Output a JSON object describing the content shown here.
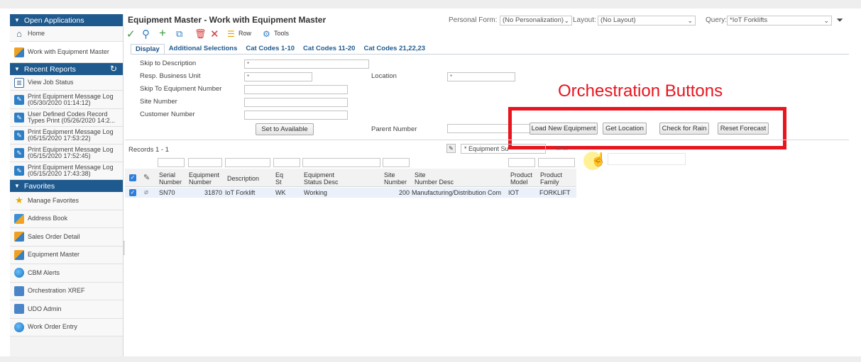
{
  "sidebar": {
    "open_apps_header": "Open Applications",
    "home": "Home",
    "open_item": "Work with Equipment Master",
    "recent_reports_header": "Recent Reports",
    "recent_reports": [
      {
        "line1": "View Job Status",
        "line2": ""
      },
      {
        "line1": "Print Equipment Message Log",
        "line2": "(05/30/2020 01:14:12)"
      },
      {
        "line1": "User Defined Codes Record",
        "line2": "Types Print (05/26/2020 14:2..."
      },
      {
        "line1": "Print Equipment Message Log",
        "line2": "(05/15/2020 17:53:22)"
      },
      {
        "line1": "Print Equipment Message Log",
        "line2": "(05/15/2020 17:52:45)"
      },
      {
        "line1": "Print Equipment Message Log",
        "line2": "(05/15/2020 17:43:38)"
      }
    ],
    "favorites_header": "Favorites",
    "favorites": [
      {
        "label": "Manage Favorites",
        "icon": "star-icon"
      },
      {
        "label": "Address Book",
        "icon": "people-icon"
      },
      {
        "label": "Sales Order Detail",
        "icon": "people-icon"
      },
      {
        "label": "Equipment Master",
        "icon": "people-icon"
      },
      {
        "label": "CBM Alerts",
        "icon": "globe-icon"
      },
      {
        "label": "Orchestration XREF",
        "icon": "monitor-icon"
      },
      {
        "label": "UDO Admin",
        "icon": "monitor-icon"
      },
      {
        "label": "Work Order Entry",
        "icon": "globe-icon"
      }
    ]
  },
  "header": {
    "title": "Equipment Master - Work with Equipment Master",
    "personal_form_label": "Personal Form:",
    "personal_form_value": "(No Personalization)",
    "layout_label": "Layout:",
    "layout_value": "(No Layout)",
    "query_label": "Query:",
    "query_value": "*IoT Forklifts"
  },
  "toolbar": {
    "row_label": "Row",
    "tools_label": "Tools"
  },
  "tabs": [
    "Display",
    "Additional Selections",
    "Cat Codes 1-10",
    "Cat Codes 11-20",
    "Cat Codes 21,22,23"
  ],
  "form": {
    "skip_desc_label": "Skip to Description",
    "skip_desc_value": "*",
    "bu_label": "Resp. Business Unit",
    "bu_value": "*",
    "location_label": "Location",
    "location_value": "*",
    "skip_equip_label": "Skip To Equipment Number",
    "site_label": "Site Number",
    "customer_label": "Customer Number",
    "parent_label": "Parent Number",
    "set_available_button": "Set to Available"
  },
  "orchestration": {
    "annotation": "Orchestration Buttons",
    "buttons": [
      "Load New Equipment",
      "Get Location",
      "Check for Rain",
      "Reset Forecast"
    ]
  },
  "grid": {
    "records": "Records 1 - 1",
    "format_value": "* Equipment Su",
    "columns": [
      {
        "l1": "Serial",
        "l2": "Number"
      },
      {
        "l1": "Equipment",
        "l2": "Number"
      },
      {
        "l1": "Description",
        "l2": ""
      },
      {
        "l1": "Eq",
        "l2": "St"
      },
      {
        "l1": "Equipment",
        "l2": "Status Desc"
      },
      {
        "l1": "Site",
        "l2": "Number"
      },
      {
        "l1": "Site",
        "l2": "Number Desc"
      },
      {
        "l1": "Product",
        "l2": "Model"
      },
      {
        "l1": "Product",
        "l2": "Family"
      }
    ],
    "rows": [
      [
        "SN70",
        "31870",
        "IoT Forklift",
        "WK",
        "Working",
        "200",
        "Manufacturing/Distribution Com",
        "IOT",
        "FORKLIFT"
      ]
    ]
  }
}
